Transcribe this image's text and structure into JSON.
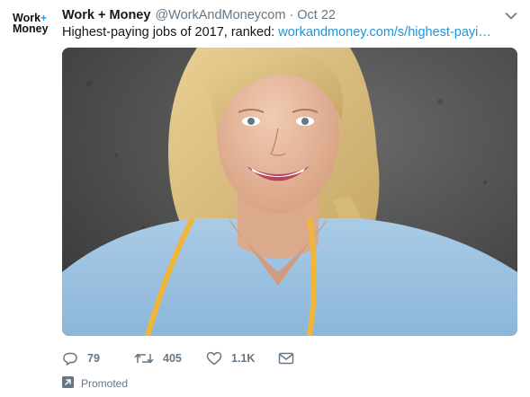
{
  "account": {
    "avatar_line1": "Work",
    "avatar_plus": "+",
    "avatar_line2": "Money",
    "name": "Work + Money",
    "handle": "@WorkAndMoneycom",
    "separator": "·",
    "date": "Oct 22"
  },
  "tweet": {
    "text": "Highest-paying jobs of 2017, ranked: ",
    "link": "workandmoney.com/s/highest-payi…"
  },
  "actions": {
    "reply_count": "79",
    "retweet_count": "405",
    "like_count": "1.1K"
  },
  "promoted_label": "Promoted",
  "icons": {
    "caret": "chevron-down-icon",
    "reply": "reply-icon",
    "retweet": "retweet-icon",
    "like": "heart-icon",
    "dm": "envelope-icon",
    "promoted": "promoted-arrow-icon"
  },
  "colors": {
    "link": "#1b95e0",
    "muted": "#657786",
    "accent": "#1da1f2"
  }
}
